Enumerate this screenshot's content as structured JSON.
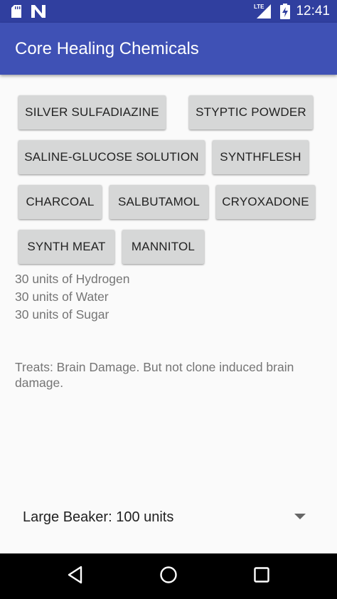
{
  "status_bar": {
    "time": "12:41",
    "network_label": "LTE",
    "icons": [
      "sd-card-icon",
      "n-notification-icon",
      "lte-signal-icon",
      "battery-charging-icon"
    ]
  },
  "app_bar": {
    "title": "Core Healing Chemicals"
  },
  "chemicals": [
    "SILVER SULFADIAZINE",
    "STYPTIC POWDER",
    "SALINE-GLUCOSE SOLUTION",
    "SYNTHFLESH",
    "CHARCOAL",
    "SALBUTAMOL",
    "CRYOXADONE",
    "SYNTH MEAT",
    "MANNITOL"
  ],
  "recipe": [
    "30 units of Hydrogen",
    "30 units of Water",
    "30 units of Sugar"
  ],
  "treats": "Treats: Brain Damage. But not clone induced brain damage.",
  "beaker_spinner": {
    "selected": "Large Beaker: 100 units"
  },
  "nav_bar": {
    "icons": [
      "back-icon",
      "home-icon",
      "recents-icon"
    ]
  },
  "colors": {
    "status_bar": "#303f9f",
    "app_bar": "#3f51b5",
    "button_bg": "#d6d7d7",
    "secondary_text": "#757575"
  }
}
